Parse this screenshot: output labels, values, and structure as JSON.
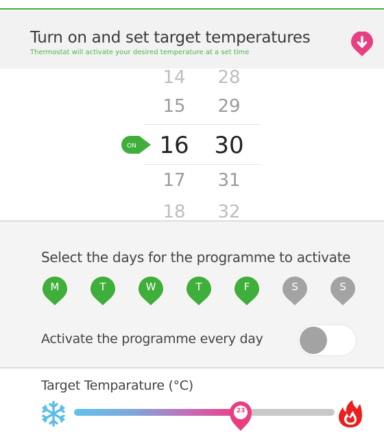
{
  "header": {
    "title": "Turn on and set target temperatures",
    "subtitle": "Thermostat will activate your desired temperature at a set time",
    "down_icon": "arrow-down-icon",
    "accent": "#e83e82"
  },
  "picker": {
    "hours": [
      "14",
      "15",
      "16",
      "17",
      "18"
    ],
    "minutes": [
      "28",
      "29",
      "30",
      "31",
      "32"
    ],
    "selected_index": 2,
    "on_label": "ON",
    "on_color": "#3fae3a"
  },
  "days": {
    "label": "Select the days for the programme to activate",
    "items": [
      {
        "label": "M",
        "active": true
      },
      {
        "label": "T",
        "active": true
      },
      {
        "label": "W",
        "active": true
      },
      {
        "label": "T",
        "active": true
      },
      {
        "label": "F",
        "active": true
      },
      {
        "label": "S",
        "active": false
      },
      {
        "label": "S",
        "active": false
      }
    ],
    "active_color": "#3fae3a",
    "inactive_color": "#a3a3a3",
    "every_day_label": "Activate the programme every day",
    "every_day_on": false
  },
  "temperature": {
    "label": "Target Temparature (°C)",
    "value": "23",
    "fraction": 0.64,
    "cold_icon": "snowflake-icon",
    "hot_icon": "flame-icon",
    "cold_color": "#5bbde8",
    "hot_color": "#e8201f"
  }
}
